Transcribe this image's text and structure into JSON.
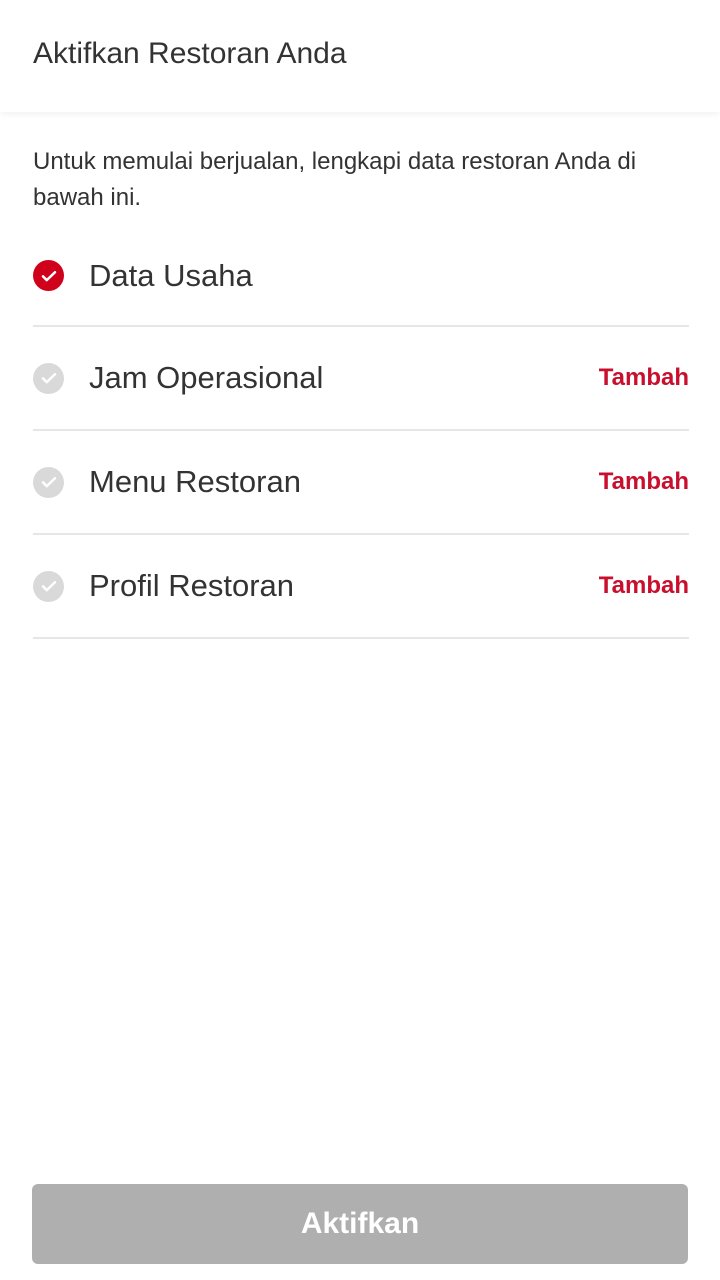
{
  "header": {
    "title": "Aktifkan Restoran Anda"
  },
  "intro": {
    "text": "Untuk memulai berjualan, lengkapi data restoran Anda di bawah ini."
  },
  "steps": [
    {
      "label": "Data Usaha",
      "completed": true,
      "action": ""
    },
    {
      "label": "Jam Operasional",
      "completed": false,
      "action": "Tambah"
    },
    {
      "label": "Menu Restoran",
      "completed": false,
      "action": "Tambah"
    },
    {
      "label": "Profil Restoran",
      "completed": false,
      "action": "Tambah"
    }
  ],
  "footer": {
    "button_label": "Aktifkan",
    "button_enabled": false
  },
  "colors": {
    "accent": "#c8102e",
    "check_done": "#d0021b",
    "check_pending": "#d9d9d9",
    "button_disabled": "#afafaf",
    "text": "#333333",
    "divider": "#e6e6e6"
  },
  "icons": {
    "done": "check-circle-filled-icon",
    "pending": "check-circle-icon"
  }
}
